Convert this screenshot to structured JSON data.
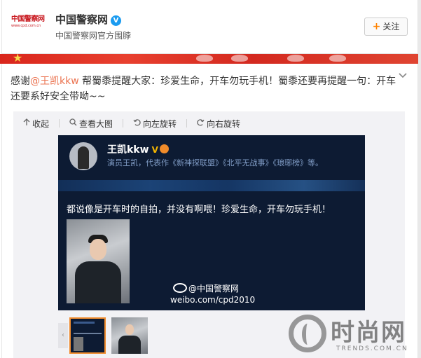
{
  "account": {
    "logo_text": "中国警察网",
    "logo_sub": "www.cpd.com.cn",
    "name": "中国警察网",
    "verified_glyph": "V",
    "description": "中国警察网官方围脖",
    "follow_label": "关注"
  },
  "post": {
    "text_prefix": "感谢",
    "mention": "@王凯kkw",
    "text_suffix": " 帮蜀黍提醒大家：珍爱生命，开车勿玩手机！蜀黍还要再提醒一句：开车还要系好安全带呦~~"
  },
  "toolbar": {
    "collapse": "收起",
    "view_large": "查看大图",
    "rotate_left": "向左旋转",
    "rotate_right": "向右旋转"
  },
  "embedded": {
    "user_name": "王凯kkw",
    "user_desc": "演员王凯，代表作《新神探联盟》《北平无战事》《琅琊榜》等。",
    "quote": "都说像是开车时的自拍，并没有啊喂！珍爱生命，开车勿玩手机！",
    "watermark": "@中国警察网",
    "watermark_url": "weibo.com/cpd2010"
  },
  "site_watermark": {
    "name": "时尚网",
    "url": "TRENDS.COM.CN"
  },
  "colors": {
    "mention": "#eb7350",
    "follow_plus": "#ff8200",
    "verified": "#1a9bf0",
    "banner": "#d9261c",
    "embedded_bg": "#0d1b33",
    "thumb_selected": "#f08c2e"
  },
  "icons": [
    "chevron-down-icon",
    "collapse-arrow-icon",
    "search-icon",
    "rotate-left-icon",
    "rotate-right-icon",
    "weibo-icon"
  ]
}
